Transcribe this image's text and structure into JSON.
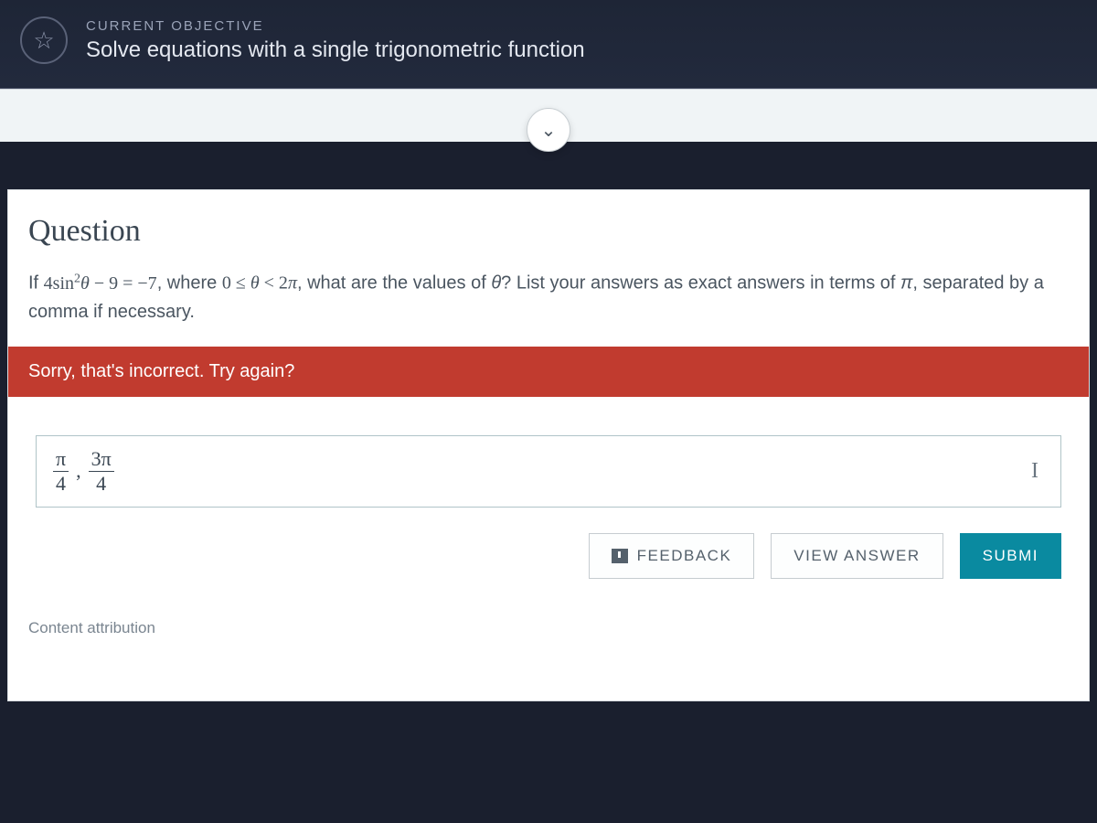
{
  "header": {
    "label": "CURRENT OBJECTIVE",
    "title": "Solve equations with a single trigonometric function"
  },
  "question": {
    "heading": "Question",
    "prompt_prefix": "If ",
    "equation": "4sin²θ − 9 = −7",
    "prompt_mid": ", where ",
    "domain": "0 ≤ θ < 2π",
    "prompt_suffix": ", what are the values of θ? List your answers as exact answers in terms of π, separated by a comma if necessary."
  },
  "error": {
    "message": "Sorry, that's incorrect. Try again?"
  },
  "answer": {
    "frac1": {
      "num": "π",
      "den": "4"
    },
    "sep": ",",
    "frac2": {
      "num": "3π",
      "den": "4"
    },
    "cursor_glyph": "I"
  },
  "buttons": {
    "feedback": "FEEDBACK",
    "view_answer": "VIEW ANSWER",
    "submit": "SUBMI"
  },
  "footer": {
    "attribution": "Content attribution"
  }
}
